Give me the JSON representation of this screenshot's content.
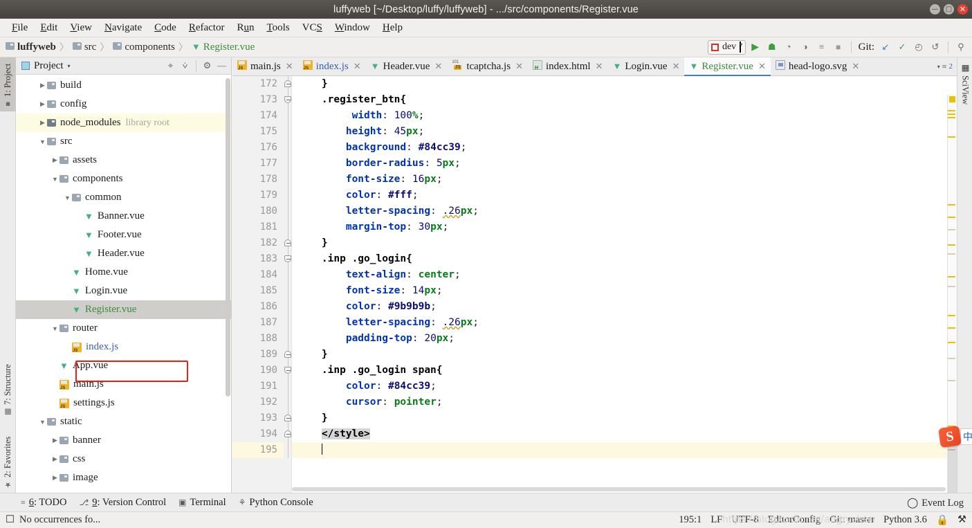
{
  "window": {
    "title": "luffyweb [~/Desktop/luffy/luffyweb] - .../src/components/Register.vue",
    "minimize_label": "—",
    "maximize_label": "□",
    "close_label": "✕"
  },
  "menubar": [
    {
      "label": "File",
      "mnemonic": "F"
    },
    {
      "label": "Edit",
      "mnemonic": "E"
    },
    {
      "label": "View",
      "mnemonic": "V"
    },
    {
      "label": "Navigate",
      "mnemonic": "N"
    },
    {
      "label": "Code",
      "mnemonic": "C"
    },
    {
      "label": "Refactor",
      "mnemonic": "R"
    },
    {
      "label": "Run",
      "mnemonic": "u"
    },
    {
      "label": "Tools",
      "mnemonic": "T"
    },
    {
      "label": "VCS",
      "mnemonic": "S"
    },
    {
      "label": "Window",
      "mnemonic": "W"
    },
    {
      "label": "Help",
      "mnemonic": "H"
    }
  ],
  "breadcrumbs": [
    {
      "label": "luffyweb",
      "icon": "folder-icon",
      "style": "bold"
    },
    {
      "label": "src",
      "icon": "folder-icon",
      "style": "normal"
    },
    {
      "label": "components",
      "icon": "folder-icon",
      "style": "normal"
    },
    {
      "label": "Register.vue",
      "icon": "vue-icon",
      "style": "green"
    }
  ],
  "toolbar": {
    "run_config": "dev",
    "run_config_caret": "▾",
    "icons": [
      {
        "name": "run-icon",
        "glyph": "▶"
      },
      {
        "name": "debug-icon",
        "glyph": "☗"
      },
      {
        "name": "run-with-coverage-icon",
        "glyph": "◔"
      },
      {
        "name": "profile-icon",
        "glyph": "◑"
      },
      {
        "name": "run-tool-window-icon",
        "glyph": "≡"
      },
      {
        "name": "stop-icon",
        "glyph": "■"
      }
    ],
    "git_label": "Git:",
    "git_icons": [
      {
        "name": "update-project-icon",
        "glyph": "↙"
      },
      {
        "name": "commit-icon",
        "glyph": "✓"
      },
      {
        "name": "history-icon",
        "glyph": "◴"
      },
      {
        "name": "rollback-icon",
        "glyph": "↺"
      }
    ],
    "search_icon": "⚲"
  },
  "left_strip": [
    {
      "label": "1: Project",
      "mnemonic": "1",
      "icon": "project-folder-icon",
      "active": true
    },
    {
      "label": "7: Structure",
      "mnemonic": "7",
      "icon": "structure-icon",
      "active": false
    },
    {
      "label": "2: Favorites",
      "mnemonic": "2",
      "icon": "star-icon",
      "active": false
    }
  ],
  "right_strip": [
    {
      "label": "SciView",
      "icon": "grid-icon"
    }
  ],
  "project_panel": {
    "title": "Project",
    "caret": "▾",
    "header_icons": [
      {
        "name": "locate-target-icon",
        "glyph": "⌖"
      },
      {
        "name": "collapse-all-icon",
        "glyph": "⩒"
      },
      {
        "name": "settings-gear-icon",
        "glyph": "⚙"
      },
      {
        "name": "hide-panel-icon",
        "glyph": "—"
      }
    ],
    "tree": [
      {
        "label": "build",
        "indent": 1,
        "arrow": "▶",
        "icon": "folder-icon",
        "state": "normal"
      },
      {
        "label": "config",
        "indent": 1,
        "arrow": "▶",
        "icon": "folder-icon",
        "state": "normal"
      },
      {
        "label": "node_modules",
        "note": "library root",
        "indent": 1,
        "arrow": "▶",
        "icon": "folder-dark-icon",
        "state": "library"
      },
      {
        "label": "src",
        "indent": 1,
        "arrow": "▼",
        "icon": "folder-icon",
        "state": "normal"
      },
      {
        "label": "assets",
        "indent": 2,
        "arrow": "▶",
        "icon": "folder-icon",
        "state": "normal"
      },
      {
        "label": "components",
        "indent": 2,
        "arrow": "▼",
        "icon": "folder-icon",
        "state": "normal"
      },
      {
        "label": "common",
        "indent": 3,
        "arrow": "▼",
        "icon": "folder-icon",
        "state": "normal"
      },
      {
        "label": "Banner.vue",
        "indent": 4,
        "arrow": "",
        "icon": "vue-icon",
        "state": "normal"
      },
      {
        "label": "Footer.vue",
        "indent": 4,
        "arrow": "",
        "icon": "vue-icon",
        "state": "normal"
      },
      {
        "label": "Header.vue",
        "indent": 4,
        "arrow": "",
        "icon": "vue-icon",
        "state": "normal"
      },
      {
        "label": "Home.vue",
        "indent": 3,
        "arrow": "",
        "icon": "vue-icon",
        "state": "normal"
      },
      {
        "label": "Login.vue",
        "indent": 3,
        "arrow": "",
        "icon": "vue-icon",
        "state": "normal"
      },
      {
        "label": "Register.vue",
        "indent": 3,
        "arrow": "",
        "icon": "vue-icon",
        "state": "selected"
      },
      {
        "label": "router",
        "indent": 2,
        "arrow": "▼",
        "icon": "folder-icon",
        "state": "normal"
      },
      {
        "label": "index.js",
        "indent": 3,
        "arrow": "",
        "icon": "js-icon",
        "state": "blue"
      },
      {
        "label": "App.vue",
        "indent": 2,
        "arrow": "",
        "icon": "vue-icon",
        "state": "normal"
      },
      {
        "label": "main.js",
        "indent": 2,
        "arrow": "",
        "icon": "js-icon",
        "state": "normal"
      },
      {
        "label": "settings.js",
        "indent": 2,
        "arrow": "",
        "icon": "js-icon",
        "state": "normal"
      },
      {
        "label": "static",
        "indent": 1,
        "arrow": "▼",
        "icon": "folder-icon",
        "state": "normal"
      },
      {
        "label": "banner",
        "indent": 2,
        "arrow": "▶",
        "icon": "folder-icon",
        "state": "normal"
      },
      {
        "label": "css",
        "indent": 2,
        "arrow": "▶",
        "icon": "folder-icon",
        "state": "normal"
      },
      {
        "label": "image",
        "indent": 2,
        "arrow": "▶",
        "icon": "folder-icon",
        "state": "normal"
      }
    ]
  },
  "editor_tabs": [
    {
      "label": "main.js",
      "icon": "js-icon",
      "active": false,
      "close": "✕"
    },
    {
      "label": "index.js",
      "icon": "js-icon",
      "active": false,
      "close": "✕",
      "color": "blue"
    },
    {
      "label": "Header.vue",
      "icon": "vue-icon",
      "active": false,
      "close": "✕"
    },
    {
      "label": "tcaptcha.js",
      "icon": "js-minified-icon",
      "active": false,
      "close": "✕"
    },
    {
      "label": "index.html",
      "icon": "html-icon",
      "active": false,
      "close": "✕"
    },
    {
      "label": "Login.vue",
      "icon": "vue-icon",
      "active": false,
      "close": "✕"
    },
    {
      "label": "Register.vue",
      "icon": "vue-icon",
      "active": true,
      "close": "✕"
    },
    {
      "label": "head-logo.svg",
      "icon": "svg-icon",
      "active": false,
      "close": "✕"
    }
  ],
  "tab_overflow": {
    "caret": "▾",
    "glyph": "≡",
    "count": "2"
  },
  "code": {
    "language": "css",
    "lines": [
      {
        "num": "172",
        "fold": "end",
        "swatch": null,
        "tokens": [
          {
            "t": "plain",
            "s": "    "
          },
          {
            "t": "tag",
            "s": "}"
          }
        ]
      },
      {
        "num": "173",
        "fold": "start",
        "swatch": null,
        "tokens": [
          {
            "t": "plain",
            "s": "    "
          },
          {
            "t": "tag",
            "s": ".register_btn{"
          }
        ]
      },
      {
        "num": "174",
        "fold": null,
        "swatch": null,
        "tokens": [
          {
            "t": "plain",
            "s": "         "
          },
          {
            "t": "prop",
            "s": "width"
          },
          {
            "t": "plain",
            "s": ": "
          },
          {
            "t": "val",
            "s": "100"
          },
          {
            "t": "unit",
            "s": "%"
          },
          {
            "t": "plain",
            "s": ";"
          }
        ]
      },
      {
        "num": "175",
        "fold": null,
        "swatch": null,
        "tokens": [
          {
            "t": "plain",
            "s": "        "
          },
          {
            "t": "prop",
            "s": "height"
          },
          {
            "t": "plain",
            "s": ": "
          },
          {
            "t": "val",
            "s": "45"
          },
          {
            "t": "unit",
            "s": "px"
          },
          {
            "t": "plain",
            "s": ";"
          }
        ]
      },
      {
        "num": "176",
        "fold": null,
        "swatch": "#84cc39",
        "tokens": [
          {
            "t": "plain",
            "s": "        "
          },
          {
            "t": "prop",
            "s": "background"
          },
          {
            "t": "plain",
            "s": ": "
          },
          {
            "t": "valb",
            "s": "#84cc39"
          },
          {
            "t": "plain",
            "s": ";"
          }
        ]
      },
      {
        "num": "177",
        "fold": null,
        "swatch": null,
        "tokens": [
          {
            "t": "plain",
            "s": "        "
          },
          {
            "t": "prop",
            "s": "border-radius"
          },
          {
            "t": "plain",
            "s": ": "
          },
          {
            "t": "val",
            "s": "5"
          },
          {
            "t": "unit",
            "s": "px"
          },
          {
            "t": "plain",
            "s": ";"
          }
        ]
      },
      {
        "num": "178",
        "fold": null,
        "swatch": null,
        "tokens": [
          {
            "t": "plain",
            "s": "        "
          },
          {
            "t": "prop",
            "s": "font-size"
          },
          {
            "t": "plain",
            "s": ": "
          },
          {
            "t": "val",
            "s": "16"
          },
          {
            "t": "unit",
            "s": "px"
          },
          {
            "t": "plain",
            "s": ";"
          }
        ]
      },
      {
        "num": "179",
        "fold": null,
        "swatch": "#ffffff",
        "tokens": [
          {
            "t": "plain",
            "s": "        "
          },
          {
            "t": "prop",
            "s": "color"
          },
          {
            "t": "plain",
            "s": ": "
          },
          {
            "t": "valb",
            "s": "#fff"
          },
          {
            "t": "plain",
            "s": ";"
          }
        ]
      },
      {
        "num": "180",
        "fold": null,
        "swatch": null,
        "tokens": [
          {
            "t": "plain",
            "s": "        "
          },
          {
            "t": "prop",
            "s": "letter-spacing"
          },
          {
            "t": "plain",
            "s": ": "
          },
          {
            "t": "wave",
            "s": ".26"
          },
          {
            "t": "unit",
            "s": "px"
          },
          {
            "t": "plain",
            "s": ";"
          }
        ]
      },
      {
        "num": "181",
        "fold": null,
        "swatch": null,
        "tokens": [
          {
            "t": "plain",
            "s": "        "
          },
          {
            "t": "prop",
            "s": "margin-top"
          },
          {
            "t": "plain",
            "s": ": "
          },
          {
            "t": "val",
            "s": "30"
          },
          {
            "t": "unit",
            "s": "px"
          },
          {
            "t": "plain",
            "s": ";"
          }
        ]
      },
      {
        "num": "182",
        "fold": "end",
        "swatch": null,
        "tokens": [
          {
            "t": "plain",
            "s": "    "
          },
          {
            "t": "tag",
            "s": "}"
          }
        ]
      },
      {
        "num": "183",
        "fold": "start",
        "swatch": null,
        "tokens": [
          {
            "t": "plain",
            "s": "    "
          },
          {
            "t": "tag",
            "s": ".inp .go_login{"
          }
        ]
      },
      {
        "num": "184",
        "fold": null,
        "swatch": null,
        "tokens": [
          {
            "t": "plain",
            "s": "        "
          },
          {
            "t": "prop",
            "s": "text-align"
          },
          {
            "t": "plain",
            "s": ": "
          },
          {
            "t": "unit",
            "s": "center"
          },
          {
            "t": "plain",
            "s": ";"
          }
        ]
      },
      {
        "num": "185",
        "fold": null,
        "swatch": null,
        "tokens": [
          {
            "t": "plain",
            "s": "        "
          },
          {
            "t": "prop",
            "s": "font-size"
          },
          {
            "t": "plain",
            "s": ": "
          },
          {
            "t": "val",
            "s": "14"
          },
          {
            "t": "unit",
            "s": "px"
          },
          {
            "t": "plain",
            "s": ";"
          }
        ]
      },
      {
        "num": "186",
        "fold": null,
        "swatch": "#9b9b9b",
        "tokens": [
          {
            "t": "plain",
            "s": "        "
          },
          {
            "t": "prop",
            "s": "color"
          },
          {
            "t": "plain",
            "s": ": "
          },
          {
            "t": "valb",
            "s": "#9b9b9b"
          },
          {
            "t": "plain",
            "s": ";"
          }
        ]
      },
      {
        "num": "187",
        "fold": null,
        "swatch": null,
        "tokens": [
          {
            "t": "plain",
            "s": "        "
          },
          {
            "t": "prop",
            "s": "letter-spacing"
          },
          {
            "t": "plain",
            "s": ": "
          },
          {
            "t": "wave",
            "s": ".26"
          },
          {
            "t": "unit",
            "s": "px"
          },
          {
            "t": "plain",
            "s": ";"
          }
        ]
      },
      {
        "num": "188",
        "fold": null,
        "swatch": null,
        "tokens": [
          {
            "t": "plain",
            "s": "        "
          },
          {
            "t": "prop",
            "s": "padding-top"
          },
          {
            "t": "plain",
            "s": ": "
          },
          {
            "t": "val",
            "s": "20"
          },
          {
            "t": "unit",
            "s": "px"
          },
          {
            "t": "plain",
            "s": ";"
          }
        ]
      },
      {
        "num": "189",
        "fold": "end",
        "swatch": null,
        "tokens": [
          {
            "t": "plain",
            "s": "    "
          },
          {
            "t": "tag",
            "s": "}"
          }
        ]
      },
      {
        "num": "190",
        "fold": "start",
        "swatch": null,
        "tokens": [
          {
            "t": "plain",
            "s": "    "
          },
          {
            "t": "tag",
            "s": ".inp .go_login span{"
          }
        ]
      },
      {
        "num": "191",
        "fold": null,
        "swatch": "#84cc39",
        "tokens": [
          {
            "t": "plain",
            "s": "        "
          },
          {
            "t": "prop",
            "s": "color"
          },
          {
            "t": "plain",
            "s": ": "
          },
          {
            "t": "valb",
            "s": "#84cc39"
          },
          {
            "t": "plain",
            "s": ";"
          }
        ]
      },
      {
        "num": "192",
        "fold": null,
        "swatch": null,
        "tokens": [
          {
            "t": "plain",
            "s": "        "
          },
          {
            "t": "prop",
            "s": "cursor"
          },
          {
            "t": "plain",
            "s": ": "
          },
          {
            "t": "unit",
            "s": "pointer"
          },
          {
            "t": "plain",
            "s": ";"
          }
        ]
      },
      {
        "num": "193",
        "fold": "end",
        "swatch": null,
        "tokens": [
          {
            "t": "plain",
            "s": "    "
          },
          {
            "t": "tag",
            "s": "}"
          }
        ]
      },
      {
        "num": "194",
        "fold": "end",
        "swatch": null,
        "tokens": [
          {
            "t": "plain",
            "s": "    "
          },
          {
            "t": "sel",
            "s": "</style>"
          }
        ]
      },
      {
        "num": "195",
        "fold": null,
        "swatch": null,
        "current": true,
        "tokens": [
          {
            "t": "plain",
            "s": "    "
          },
          {
            "t": "caret",
            "s": ""
          }
        ]
      }
    ]
  },
  "bottom_bar": [
    {
      "label": "6: TODO",
      "mnemonic": "6",
      "icon": "todo-list-icon"
    },
    {
      "label": "9: Version Control",
      "mnemonic": "9",
      "icon": "branch-icon"
    },
    {
      "label": "Terminal",
      "mnemonic": "",
      "icon": "terminal-icon"
    },
    {
      "label": "Python Console",
      "mnemonic": "",
      "icon": "python-icon"
    }
  ],
  "event_log": {
    "label": "Event Log",
    "icon": "balloon-icon"
  },
  "status_bar": {
    "message": "No occurrences fo...",
    "message_icon": "editor-icon",
    "caret_position": "195:1",
    "line_separator": "LF",
    "encoding": "UTF-8",
    "editorconfig": "EditorConfig",
    "git_branch": "Git: master",
    "interpreter": "Python 3.6",
    "lock_icon": "lock-icon",
    "inspection_icon": "inspections-icon"
  },
  "watermark": "https://blog.csdn.net/angryshen",
  "ime": {
    "badge": "S",
    "mode": "中"
  },
  "colors": {
    "accent_green": "#84cc39",
    "tab_active_underline": "#3a7fd5",
    "selection_red_box": "#f01c15",
    "gutter_bg": "#f1f1f1",
    "current_line": "#fdf9e0"
  }
}
